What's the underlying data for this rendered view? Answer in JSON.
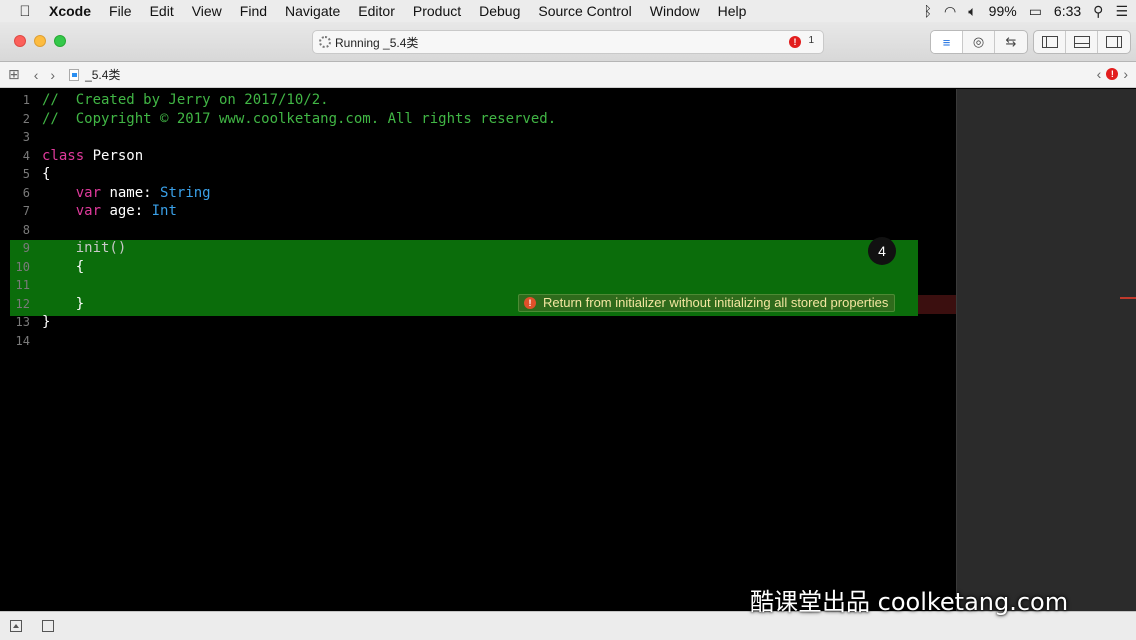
{
  "menubar": {
    "apple": "",
    "items": [
      "Xcode",
      "File",
      "Edit",
      "View",
      "Find",
      "Navigate",
      "Editor",
      "Product",
      "Debug",
      "Source Control",
      "Window",
      "Help"
    ],
    "battery": "99%",
    "clock": "6:33",
    "icons": [
      "bluetooth-icon",
      "wifi-icon",
      "volume-icon",
      "battery-icon",
      "spotlight-icon",
      "notification-center-icon"
    ]
  },
  "toolbar": {
    "activity_status": "Running _5.4类",
    "error_count": "1",
    "error_badge": "!"
  },
  "jumpbar": {
    "file_name": "_5.4类",
    "error_badge": "!"
  },
  "editor": {
    "lines": [
      {
        "n": "1",
        "parts": [
          {
            "t": "//  Created by Jerry on 2017/10/2.",
            "c": "c-comment"
          }
        ]
      },
      {
        "n": "2",
        "parts": [
          {
            "t": "//  Copyright © 2017 www.coolketang.com. All rights reserved.",
            "c": "c-comment"
          }
        ]
      },
      {
        "n": "3",
        "parts": []
      },
      {
        "n": "4",
        "parts": [
          {
            "t": "class",
            "c": "c-kw"
          },
          {
            "t": " Person",
            "c": "c-plain"
          }
        ]
      },
      {
        "n": "5",
        "parts": [
          {
            "t": "{",
            "c": "c-plain"
          }
        ]
      },
      {
        "n": "6",
        "parts": [
          {
            "t": "    ",
            "c": "c-plain"
          },
          {
            "t": "var",
            "c": "c-kw"
          },
          {
            "t": " name: ",
            "c": "c-plain"
          },
          {
            "t": "String",
            "c": "c-type"
          }
        ]
      },
      {
        "n": "7",
        "parts": [
          {
            "t": "    ",
            "c": "c-plain"
          },
          {
            "t": "var",
            "c": "c-kw"
          },
          {
            "t": " age: ",
            "c": "c-plain"
          },
          {
            "t": "Int",
            "c": "c-type"
          }
        ]
      },
      {
        "n": "8",
        "parts": []
      },
      {
        "n": "9",
        "parts": [
          {
            "t": "    init()",
            "c": "c-dim"
          }
        ]
      },
      {
        "n": "10",
        "parts": [
          {
            "t": "    {",
            "c": "c-plain"
          }
        ]
      },
      {
        "n": "11",
        "parts": []
      },
      {
        "n": "12",
        "parts": [
          {
            "t": "    }",
            "c": "c-plain"
          }
        ]
      },
      {
        "n": "13",
        "parts": [
          {
            "t": "}",
            "c": "c-plain"
          }
        ]
      },
      {
        "n": "14",
        "parts": []
      }
    ],
    "step_badge": "4",
    "issue_icon": "!",
    "issue_message": "Return from initializer without initializing all stored properties"
  },
  "watermark": "酷课堂出品 coolketang.com",
  "colors": {
    "highlight": "#0b6d0b",
    "comment": "#41b645",
    "keyword": "#e03a9c",
    "type": "#3aa0e8"
  }
}
